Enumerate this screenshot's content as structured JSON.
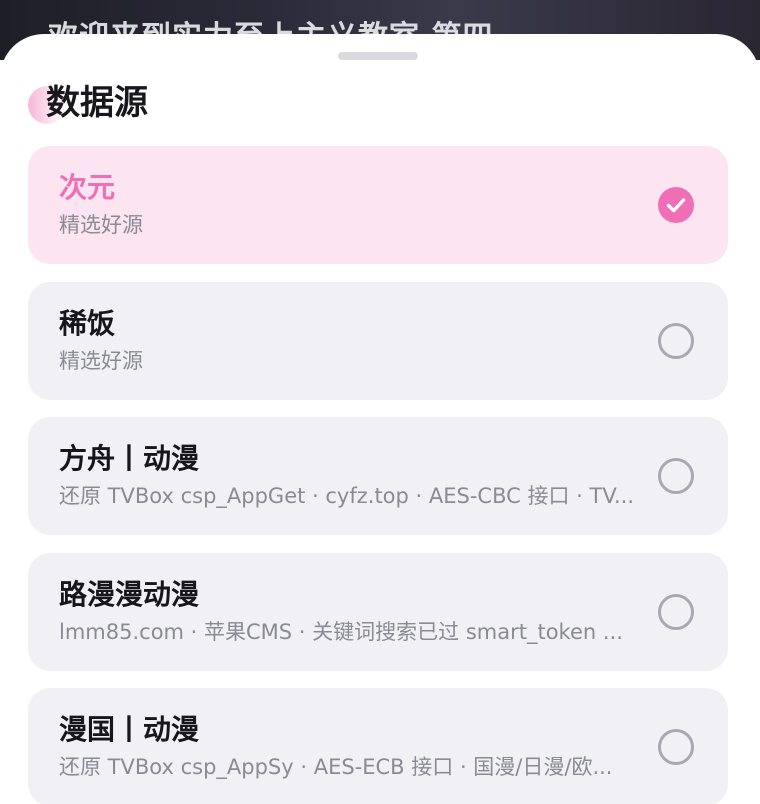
{
  "backdrop": {
    "title": "欢迎来到实力至上主义教室 第四"
  },
  "sheet": {
    "section_title": "数据源",
    "sources": [
      {
        "name": "次元",
        "desc": "精选好源",
        "selected": true
      },
      {
        "name": "稀饭",
        "desc": "精选好源",
        "selected": false
      },
      {
        "name": "方舟丨动漫",
        "desc": "还原 TVBox csp_AppGet · cyfz.top · AES-CBC 接口 · TV...",
        "selected": false
      },
      {
        "name": "路漫漫动漫",
        "desc": "lmm85.com · 苹果CMS · 关键词搜索已过 smart_token ...",
        "selected": false
      },
      {
        "name": "漫国丨动漫",
        "desc": "还原 TVBox csp_AppSy · AES-ECB 接口 · 国漫/日漫/欧...",
        "selected": false
      }
    ]
  },
  "colors": {
    "accent": "#f06eb5",
    "selected_bg": "#fce4f1",
    "card_bg": "#f1f1f5",
    "muted_text": "#8a8a95",
    "radio_border": "#a8a8b2"
  },
  "icons": {
    "selected": "check-circle-icon",
    "unselected": "radio-empty-icon"
  }
}
